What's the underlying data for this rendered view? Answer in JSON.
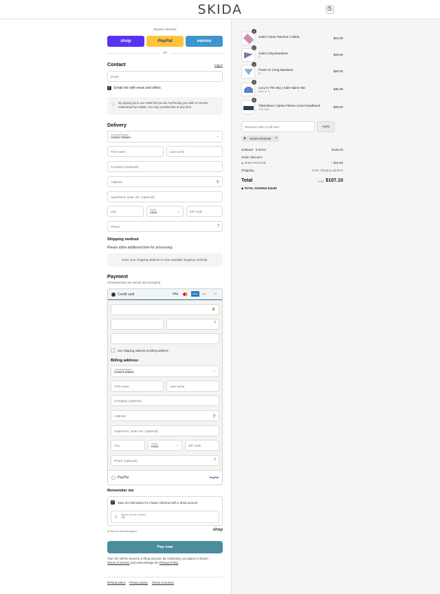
{
  "brand": {
    "logo": "SKIDA"
  },
  "express": {
    "label": "Express checkout",
    "shop": "shop",
    "paypal": "PayPal",
    "venmo": "venmo",
    "or": "OR"
  },
  "contact": {
    "title": "Contact",
    "login": "Log in",
    "email_placeholder": "Email",
    "news_label": "Email me with news and offers",
    "notice": "By signing up to our email list you are confirming you wish to receive marketing from Skida. You may unsubscribe at any time."
  },
  "delivery": {
    "title": "Delivery",
    "country_label": "Country/Region",
    "country_value": "United States",
    "first": "First name",
    "last": "Last name",
    "company": "Company (optional)",
    "address": "Address",
    "apartment": "Apartment, suite, etc. (optional)",
    "city": "City",
    "state_label": "State",
    "state_value": "Iowa",
    "zip": "ZIP code",
    "phone": "Phone"
  },
  "shipping": {
    "title": "Shipping method",
    "note": "Please allow additional time for processing",
    "placeholder": "Enter your shipping address to view available shipping methods."
  },
  "payment": {
    "title": "Payment",
    "subtitle": "All transactions are secure and encrypted.",
    "credit": "Credit card",
    "cards": [
      "VISA",
      "MC",
      "AMEX",
      "DISC",
      "+4"
    ],
    "same_addr": "Use shipping address as billing address",
    "paypal": "PayPal",
    "paypal_logo": "PayPal"
  },
  "billing": {
    "title": "Billing address",
    "country_label": "Country/Region",
    "country_value": "United States",
    "first": "First name",
    "last": "Last name",
    "company": "Company (optional)",
    "address": "Address",
    "apartment": "Apartment, suite, etc. (optional)",
    "city": "City",
    "state_label": "State",
    "state_value": "Iowa",
    "zip": "ZIP code",
    "phone": "Phone (optional)"
  },
  "remember": {
    "title": "Remember me",
    "save": "Save my information for a faster checkout with a Shop account",
    "mobile_label": "Mobile phone number",
    "mobile_value": "+1",
    "secure": "Secure and encrypted",
    "shop": "shop"
  },
  "pay": {
    "button": "Pay now",
    "legal_1": "Your info will be saved to a Shop account. By continuing, you agree to Shop's",
    "terms": "Terms of Service",
    "legal_2": "and acknowledge the",
    "privacy": "Privacy Policy",
    "period": "."
  },
  "footer": {
    "links": [
      "Refund policy",
      "Privacy policy",
      "Terms of service"
    ]
  },
  "summary": {
    "items": [
      {
        "qty": "1",
        "name": "Juliet | Nose Patches x Skida",
        "variant": "",
        "price": "$10.00",
        "color": "#c98fb0"
      },
      {
        "qty": "1",
        "name": "Juliet | Dog Bandana",
        "variant": "S",
        "price": "$26.00",
        "color": "#8a6f9e"
      },
      {
        "qty": "1",
        "name": "Fresh Air | Dog Bandana",
        "variant": "M",
        "price": "$26.00",
        "color": "#8fb3cf"
      },
      {
        "qty": "1",
        "name": "Lucy In The Sky | Kids Alpine Hat",
        "variant": "Kids (2-7)",
        "price": "$36.00",
        "color": "#5d86c2"
      },
      {
        "qty": "1",
        "name": "Tidal Wave | Alpine Fleece-Lined Headband",
        "variant": "One Size",
        "price": "$28.00",
        "color": "#2f3f57"
      }
    ],
    "discount_placeholder": "Discount code or gift card",
    "apply": "Apply",
    "code": "SKIDA-RX4GHB",
    "subtotal_label": "Subtotal · 5 items",
    "subtotal": "$126.00",
    "order_discount": "Order discount",
    "discount_code": "SKIDA-RX4GHB",
    "discount_amount": "− $18.90",
    "shipping_label": "Shipping",
    "shipping_value": "Enter shipping address",
    "total_label": "Total",
    "currency": "USD",
    "total": "$107.10",
    "savings_label": "TOTAL SAVINGS",
    "savings": "$18.90"
  }
}
